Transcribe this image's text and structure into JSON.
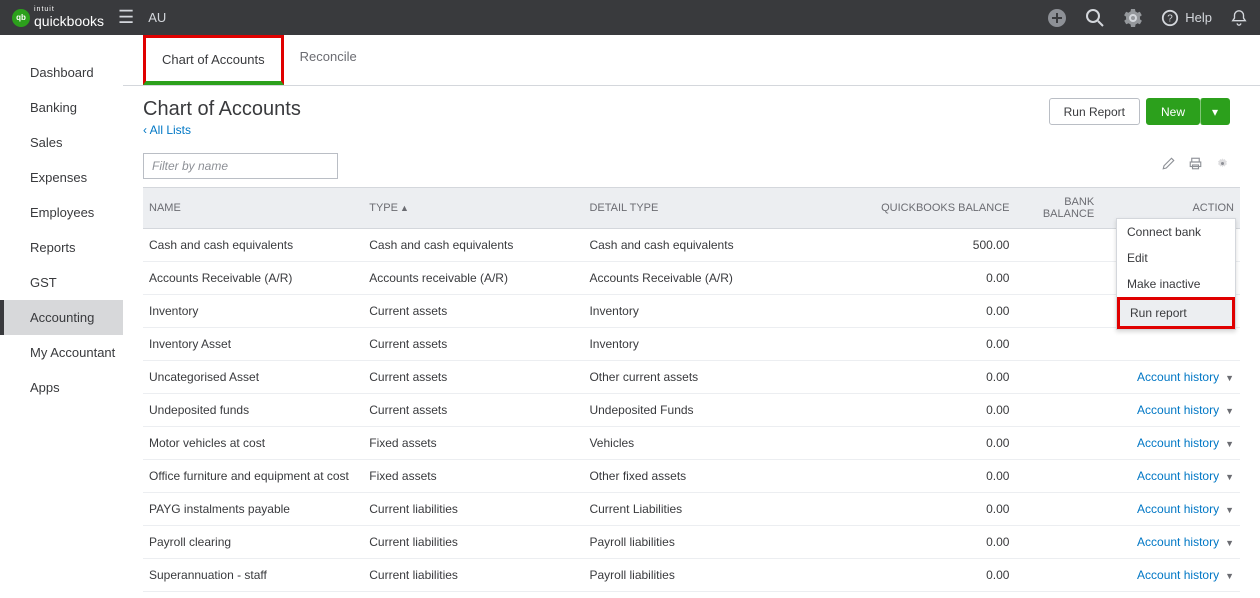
{
  "topbar": {
    "brand_small": "intuit",
    "brand": "quickbooks",
    "region": "AU",
    "help_label": "Help"
  },
  "sidebar": {
    "items": [
      {
        "label": "Dashboard"
      },
      {
        "label": "Banking"
      },
      {
        "label": "Sales"
      },
      {
        "label": "Expenses"
      },
      {
        "label": "Employees"
      },
      {
        "label": "Reports"
      },
      {
        "label": "GST"
      },
      {
        "label": "Accounting",
        "active": true
      },
      {
        "label": "My Accountant"
      },
      {
        "label": "Apps"
      }
    ]
  },
  "tabs": {
    "chart": "Chart of Accounts",
    "reconcile": "Reconcile"
  },
  "header": {
    "title": "Chart of Accounts",
    "breadcrumb": "All Lists",
    "run_report": "Run Report",
    "new": "New"
  },
  "filter": {
    "placeholder": "Filter by name"
  },
  "columns": {
    "name": "NAME",
    "type": "TYPE",
    "detail": "DETAIL TYPE",
    "qb_balance": "QUICKBOOKS BALANCE",
    "bank_balance": "BANK BALANCE",
    "action": "ACTION"
  },
  "action_label": "Account history",
  "dropdown": {
    "connect": "Connect bank",
    "edit": "Edit",
    "inactive": "Make inactive",
    "run_report": "Run report"
  },
  "rows": [
    {
      "name": "Cash and cash equivalents",
      "type": "Cash and cash equivalents",
      "detail": "Cash and cash equivalents",
      "qb": "500.00",
      "bank": ""
    },
    {
      "name": "Accounts Receivable (A/R)",
      "type": "Accounts receivable (A/R)",
      "detail": "Accounts Receivable (A/R)",
      "qb": "0.00",
      "bank": ""
    },
    {
      "name": "Inventory",
      "type": "Current assets",
      "detail": "Inventory",
      "qb": "0.00",
      "bank": ""
    },
    {
      "name": "Inventory Asset",
      "type": "Current assets",
      "detail": "Inventory",
      "qb": "0.00",
      "bank": ""
    },
    {
      "name": "Uncategorised Asset",
      "type": "Current assets",
      "detail": "Other current assets",
      "qb": "0.00",
      "bank": ""
    },
    {
      "name": "Undeposited funds",
      "type": "Current assets",
      "detail": "Undeposited Funds",
      "qb": "0.00",
      "bank": ""
    },
    {
      "name": "Motor vehicles at cost",
      "type": "Fixed assets",
      "detail": "Vehicles",
      "qb": "0.00",
      "bank": ""
    },
    {
      "name": "Office furniture and equipment at cost",
      "type": "Fixed assets",
      "detail": "Other fixed assets",
      "qb": "0.00",
      "bank": ""
    },
    {
      "name": "PAYG instalments payable",
      "type": "Current liabilities",
      "detail": "Current Liabilities",
      "qb": "0.00",
      "bank": ""
    },
    {
      "name": "Payroll clearing",
      "type": "Current liabilities",
      "detail": "Payroll liabilities",
      "qb": "0.00",
      "bank": ""
    },
    {
      "name": "Superannuation - staff",
      "type": "Current liabilities",
      "detail": "Payroll liabilities",
      "qb": "0.00",
      "bank": ""
    }
  ]
}
